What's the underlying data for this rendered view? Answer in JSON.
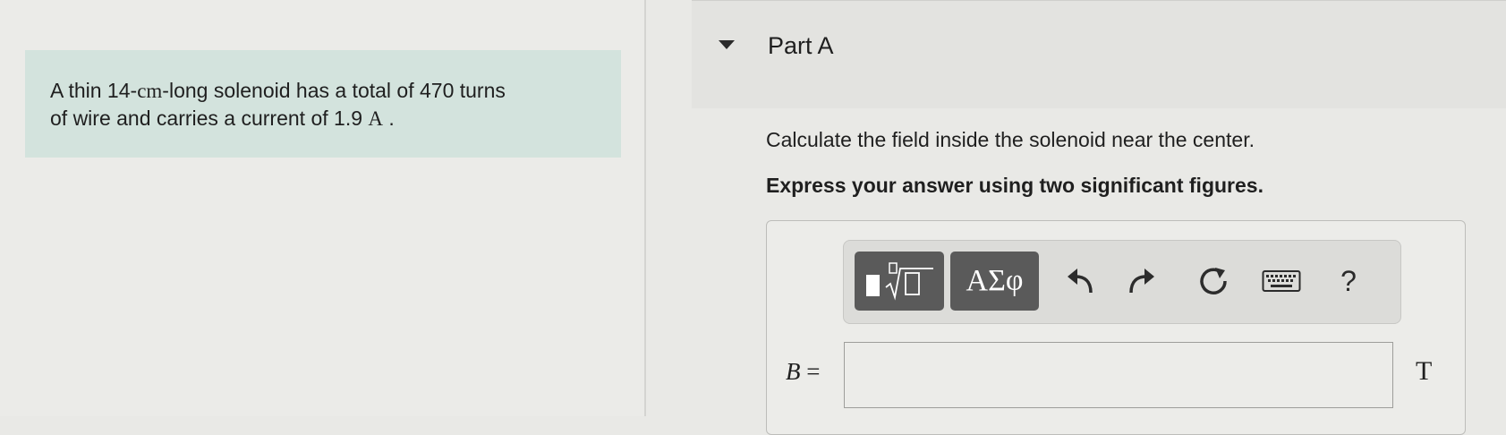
{
  "problem": {
    "text_line1_before": "A thin 14-",
    "unit_cm": "cm",
    "text_line1_after": "-long solenoid has a total of 470 turns",
    "text_line2_before": "of wire and carries a current of 1.9 ",
    "unit_A": "A",
    "text_line2_after": " ."
  },
  "part": {
    "title": "Part A"
  },
  "question": {
    "prompt": "Calculate the field inside the solenoid near the center.",
    "instruction": "Express your answer using two significant figures."
  },
  "toolbar": {
    "greek_label": "ΑΣφ",
    "help_label": "?",
    "icons": [
      "template-icon",
      "undo-icon",
      "redo-icon",
      "reset-icon",
      "keyboard-icon",
      "help-icon"
    ]
  },
  "answer": {
    "variable": "B",
    "equals": "=",
    "value": "",
    "unit": "T"
  }
}
